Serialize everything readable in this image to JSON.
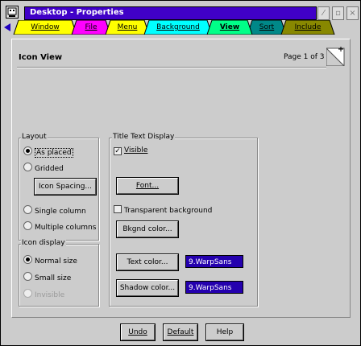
{
  "window": {
    "title": "Desktop - Properties",
    "title_bar_color": "#4000c8",
    "controls": [
      "minimize-icon",
      "maximize-icon",
      "close-icon"
    ]
  },
  "tabs": [
    {
      "label": "Window",
      "color": "#ffff00"
    },
    {
      "label": "File",
      "color": "#ff00ff"
    },
    {
      "label": "Menu",
      "color": "#ffff00"
    },
    {
      "label": "Background",
      "color": "#00ffff"
    },
    {
      "label": "View",
      "color": "#00ff88",
      "active": true
    },
    {
      "label": "Sort",
      "color": "#008888"
    },
    {
      "label": "Include",
      "color": "#888800"
    }
  ],
  "page": {
    "title": "Icon View",
    "page_info": "Page 1 of 3"
  },
  "layout": {
    "legend": "Layout",
    "options": [
      {
        "label": "As placed",
        "selected": true
      },
      {
        "label": "Gridded",
        "selected": false
      }
    ],
    "icon_spacing_button": "Icon Spacing...",
    "column_options": [
      {
        "label": "Single column",
        "selected": false
      },
      {
        "label": "Multiple columns",
        "selected": false
      }
    ]
  },
  "icon_display": {
    "legend": "Icon display",
    "options": [
      {
        "label": "Normal size",
        "selected": true,
        "disabled": false
      },
      {
        "label": "Small size",
        "selected": false,
        "disabled": false
      },
      {
        "label": "Invisible",
        "selected": false,
        "disabled": true
      }
    ]
  },
  "title_text_display": {
    "legend": "Title Text Display",
    "visible_label": "Visible",
    "visible_checked": true,
    "font_button": "Font...",
    "transparent_label": "Transparent background",
    "transparent_checked": false,
    "bkgnd_color_button": "Bkgnd color...",
    "text_color_button": "Text color...",
    "text_color_value": "9.WarpSans",
    "shadow_color_button": "Shadow color...",
    "shadow_color_value": "9.WarpSans",
    "swatch_color": "#2400ae"
  },
  "footer": {
    "undo": "Undo",
    "default": "Default",
    "help": "Help"
  }
}
